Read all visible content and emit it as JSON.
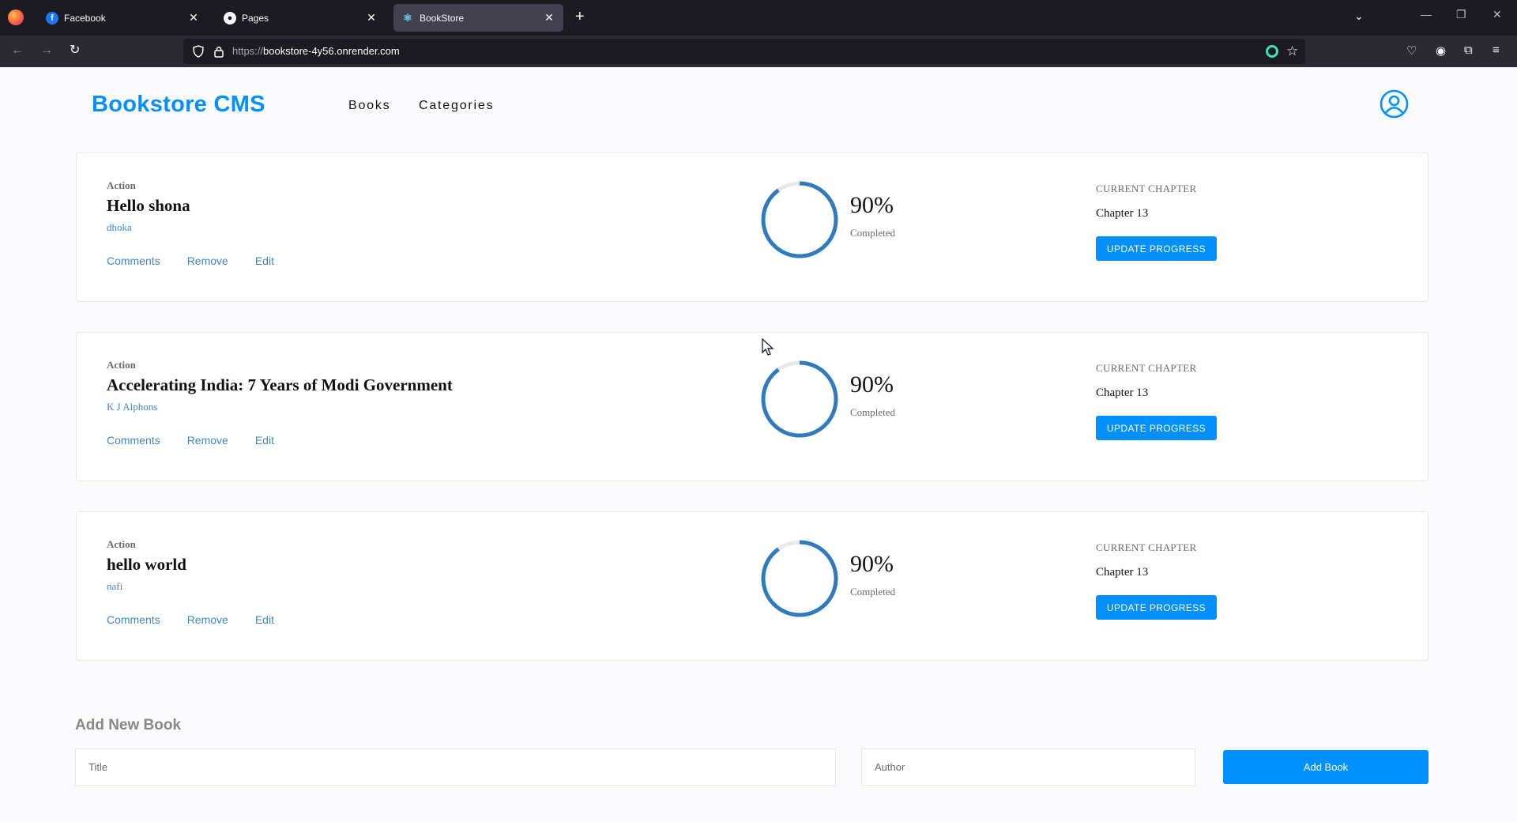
{
  "browser": {
    "tabs": [
      {
        "label": "Facebook",
        "favicon": "facebook-icon",
        "active": false
      },
      {
        "label": "Pages",
        "favicon": "github-icon",
        "active": false
      },
      {
        "label": "BookStore",
        "favicon": "react-icon",
        "active": true
      }
    ],
    "url": {
      "protocol": "https://",
      "host": "bookstore-4y56.onrender.com"
    }
  },
  "header": {
    "brand": "Bookstore CMS",
    "nav": [
      "Books",
      "Categories"
    ]
  },
  "books": [
    {
      "genre": "Action",
      "title": "Hello shona",
      "author": "dhoka",
      "progress": 90,
      "percent_text": "90%",
      "completed_label": "Completed",
      "chapter_label": "CURRENT CHAPTER",
      "chapter": "Chapter 13",
      "update_label": "UPDATE PROGRESS"
    },
    {
      "genre": "Action",
      "title": "Accelerating India: 7 Years of Modi Government",
      "author": "K J Alphons",
      "progress": 90,
      "percent_text": "90%",
      "completed_label": "Completed",
      "chapter_label": "CURRENT CHAPTER",
      "chapter": "Chapter 13",
      "update_label": "UPDATE PROGRESS"
    },
    {
      "genre": "Action",
      "title": "hello world",
      "author": "nafi",
      "progress": 90,
      "percent_text": "90%",
      "completed_label": "Completed",
      "chapter_label": "CURRENT CHAPTER",
      "chapter": "Chapter 13",
      "update_label": "UPDATE PROGRESS"
    }
  ],
  "book_actions": [
    "Comments",
    "Remove",
    "Edit"
  ],
  "add_form": {
    "heading": "Add New Book",
    "title_placeholder": "Title",
    "author_placeholder": "Author",
    "button_label": "Add Book"
  },
  "colors": {
    "accent": "#0290ff",
    "ring": "#307bbe",
    "link": "#4386bf"
  }
}
